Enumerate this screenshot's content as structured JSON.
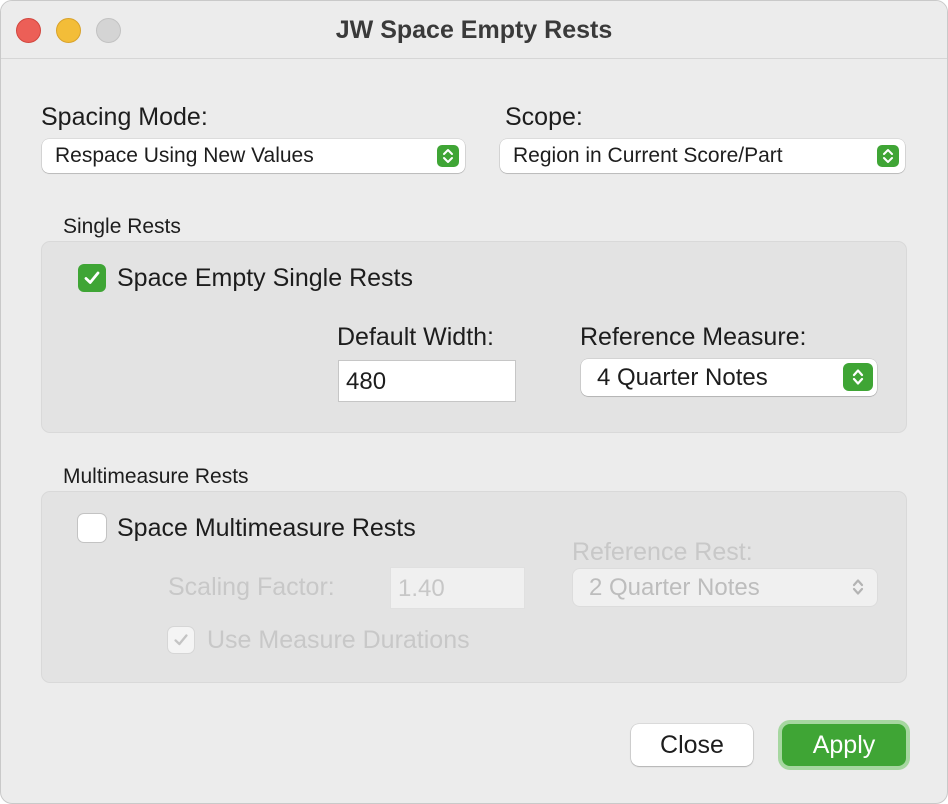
{
  "window": {
    "title": "JW Space Empty Rests"
  },
  "colors": {
    "accent": "#3fa535",
    "focus_ring": "#a6d7a0",
    "close_light": "#ec5f57",
    "minimize_light": "#f3bd38",
    "zoom_light_inactive": "#d4d4d4"
  },
  "icons": {
    "popup_arrows": "up-down-chevron-icon",
    "check": "checkmark-icon"
  },
  "spacing_mode": {
    "label": "Spacing Mode:",
    "value": "Respace Using New Values"
  },
  "scope": {
    "label": "Scope:",
    "value": "Region in Current Score/Part"
  },
  "single_rests": {
    "section_label": "Single Rests",
    "checkbox_label": "Space Empty Single Rests",
    "checked": true,
    "default_width_label": "Default Width:",
    "default_width_value": "480",
    "reference_measure_label": "Reference Measure:",
    "reference_measure_value": "4 Quarter Notes"
  },
  "multimeasure_rests": {
    "section_label": "Multimeasure Rests",
    "checkbox_label": "Space Multimeasure Rests",
    "checked": false,
    "scaling_factor_label": "Scaling Factor:",
    "scaling_factor_value": "1.40",
    "reference_rest_label": "Reference Rest:",
    "reference_rest_value": "2 Quarter Notes",
    "use_measure_durations_label": "Use Measure Durations",
    "use_measure_durations_checked": true
  },
  "buttons": {
    "close": "Close",
    "apply": "Apply"
  }
}
